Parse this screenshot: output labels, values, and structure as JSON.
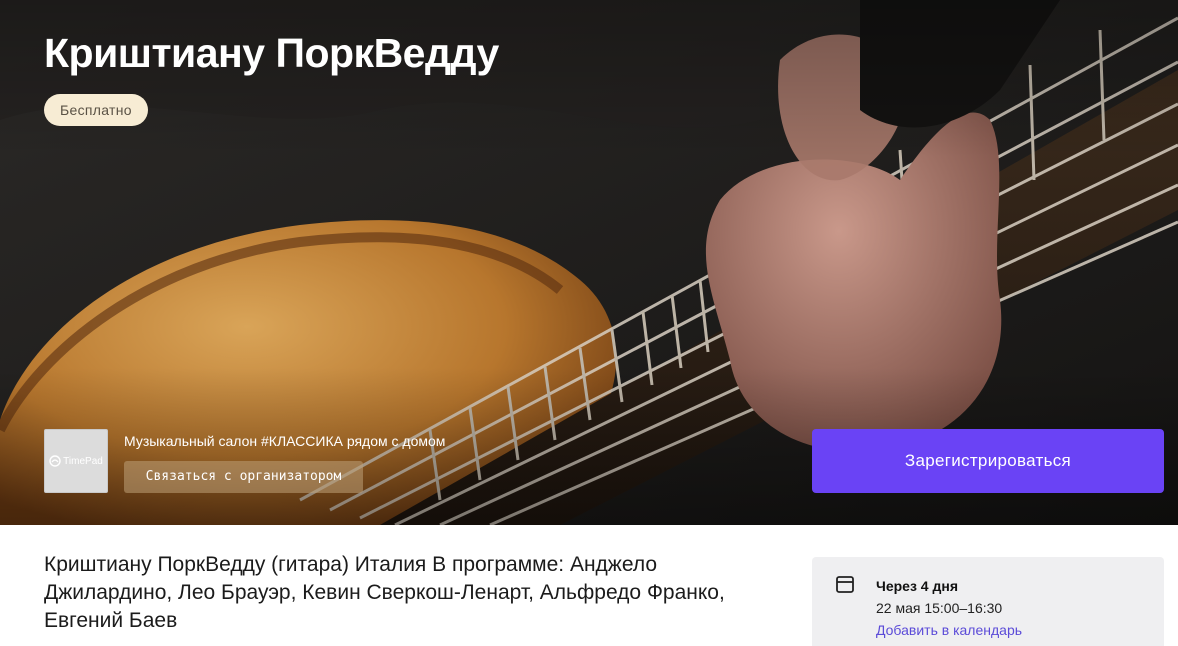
{
  "event": {
    "title": "Криштиану ПоркВедду",
    "price_badge": "Бесплатно"
  },
  "organizer": {
    "logo_text": "TimePad",
    "name": "Музыкальный салон #КЛАССИКА рядом с домом",
    "contact_label": "Связаться с организатором"
  },
  "actions": {
    "register_label": "Зарегистрироваться"
  },
  "description": "Криштиану ПоркВедду (гитара) Италия В программе: Анджело Джилардино, Лео Брауэр, Кевин Сверкош-Ленарт, Альфредо Франко, Евгений Баев",
  "schedule": {
    "relative": "Через 4 дня",
    "range": "22 мая 15:00–16:30",
    "add_to_calendar": "Добавить в календарь"
  },
  "colors": {
    "accent": "#6a43f5",
    "badge_bg": "#f7ecd4",
    "link": "#5b4bd8",
    "card_bg": "#efeff1"
  },
  "icons": {
    "calendar": "calendar-icon",
    "hero": "guitar-photo"
  }
}
